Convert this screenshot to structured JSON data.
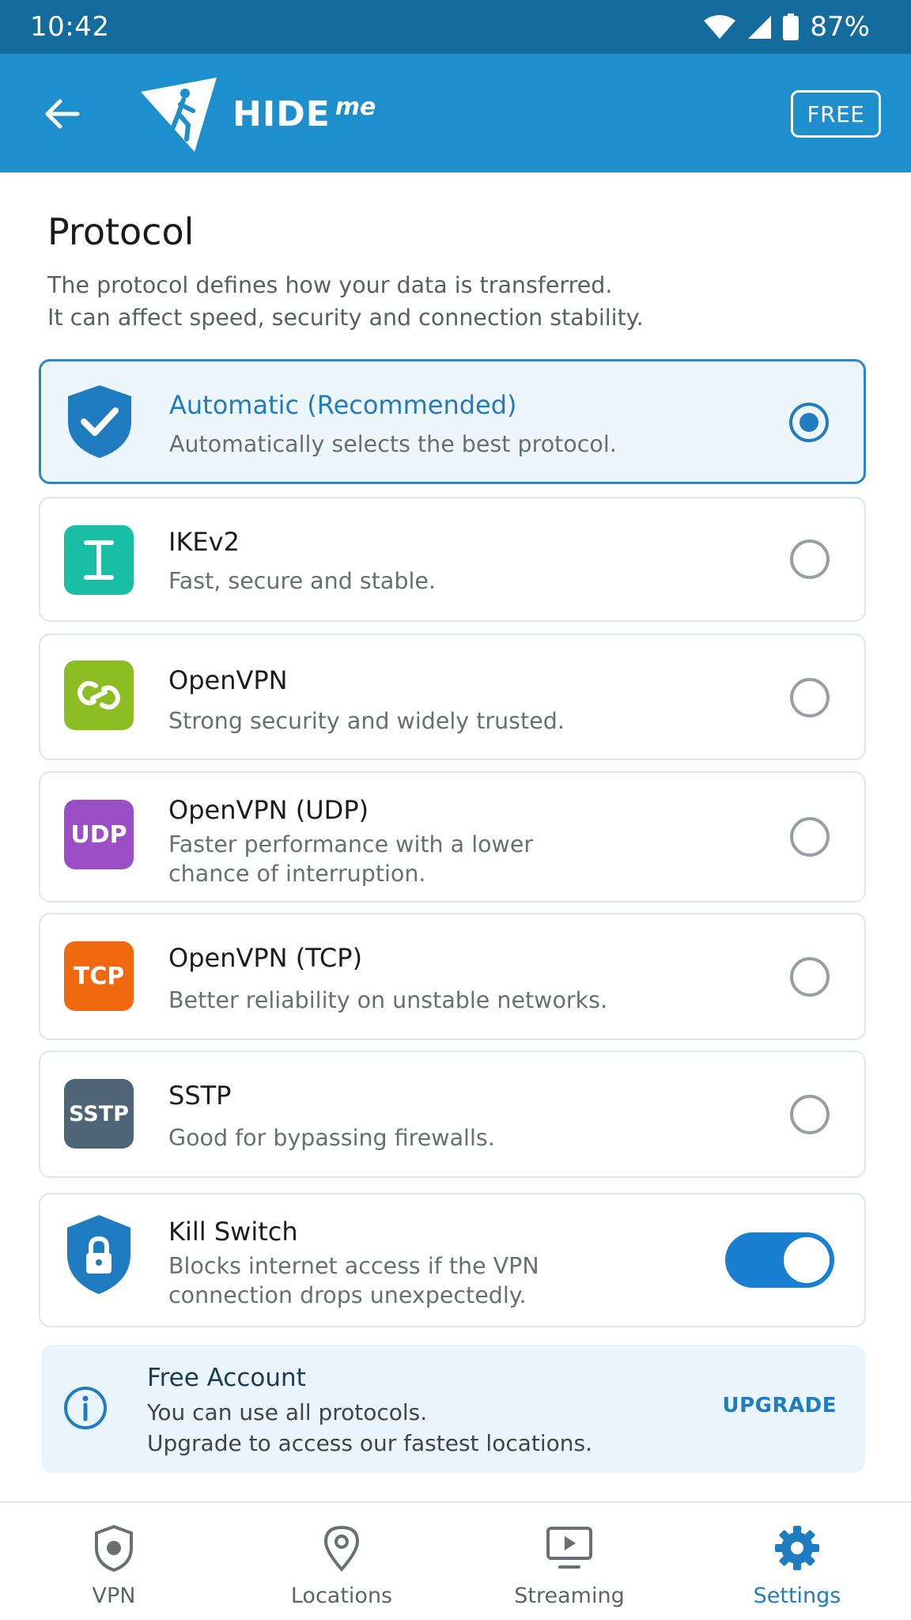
{
  "status_bar": {
    "time": "10:42",
    "battery": "87%"
  },
  "app_bar": {
    "back_label": "Back",
    "brand": "HIDE",
    "brand_sup": "me",
    "badge": "FREE"
  },
  "header": {
    "title": "Protocol",
    "subtitle_line1": "The protocol defines how your data is transferred.",
    "subtitle_line2": "It can affect speed, security and connection stability."
  },
  "protocols": [
    {
      "name": "Automatic (Recommended)",
      "desc": "Automatically selects the best protocol.",
      "icon": "shield-check-icon",
      "color": "#1f7cc0",
      "selected": true
    },
    {
      "name": "IKEv2",
      "desc": "Fast, secure and stable.",
      "icon": "ikev2-icon",
      "badge": "I",
      "color": "#19bfa4",
      "selected": false
    },
    {
      "name": "OpenVPN",
      "desc": "Strong security and widely trusted.",
      "icon": "link-icon",
      "color": "#8cbd23",
      "selected": false
    },
    {
      "name": "OpenVPN (UDP)",
      "desc_line1": "Faster performance with a lower",
      "desc_line2": "chance of interruption.",
      "icon": "udp-icon",
      "badge": "UDP",
      "color": "#9b4fc7",
      "selected": false
    },
    {
      "name": "OpenVPN (TCP)",
      "desc": "Better reliability on unstable networks.",
      "icon": "tcp-icon",
      "badge": "TCP",
      "color": "#f0690f",
      "selected": false
    },
    {
      "name": "SSTP",
      "desc": "Good for bypassing firewalls.",
      "icon": "sstp-icon",
      "badge": "SSTP",
      "color": "#4e6577",
      "selected": false
    }
  ],
  "kill_switch": {
    "name": "Kill Switch",
    "desc_line1": "Blocks internet access if the VPN",
    "desc_line2": "connection drops unexpectedly.",
    "icon": "shield-lock-icon",
    "enabled": true
  },
  "account_info": {
    "title": "Free Account",
    "line1": "You can use all protocols.",
    "line2": "Upgrade to access our fastest locations.",
    "action": "UPGRADE"
  },
  "bottom_nav": [
    {
      "label": "VPN",
      "icon": "shield-icon",
      "active": false
    },
    {
      "label": "Locations",
      "icon": "location-pin-icon",
      "active": false
    },
    {
      "label": "Streaming",
      "icon": "monitor-play-icon",
      "active": false
    },
    {
      "label": "Settings",
      "icon": "gear-icon",
      "active": true
    }
  ],
  "colors": {
    "primary": "#1e8fcd",
    "status_bar": "#146b9e",
    "accent": "#1f7cc0"
  }
}
